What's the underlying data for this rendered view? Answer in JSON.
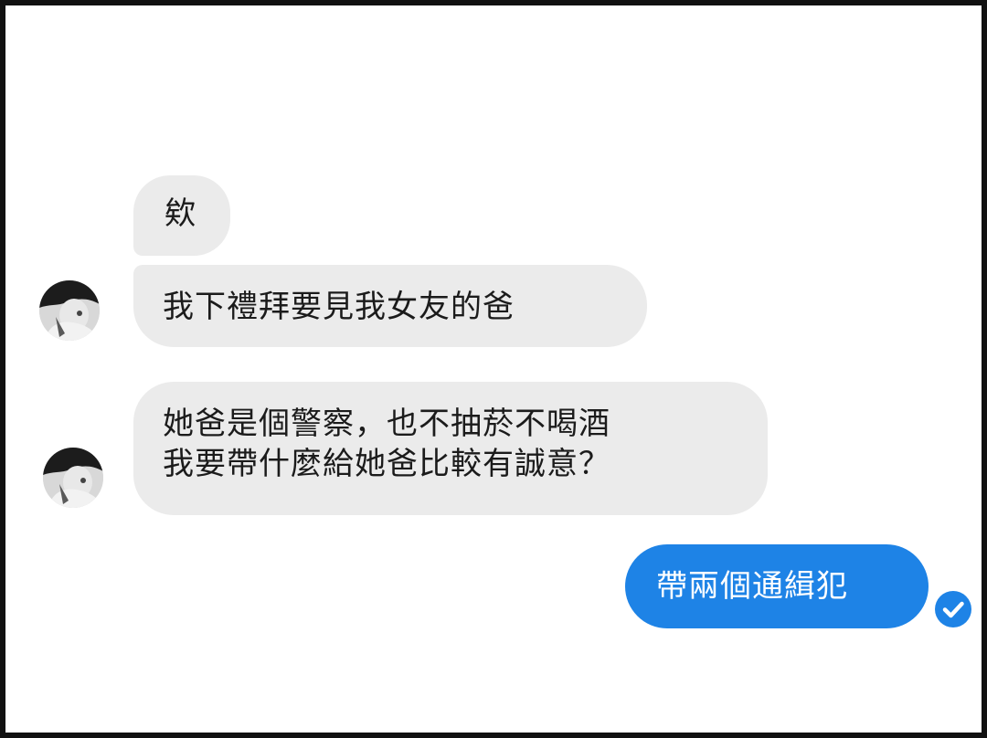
{
  "conversation": {
    "messages": [
      {
        "sender": "other",
        "lines": [
          "欸"
        ]
      },
      {
        "sender": "other",
        "lines": [
          "我下禮拜要見我女友的爸"
        ]
      },
      {
        "sender": "other",
        "lines": [
          "她爸是個警察，也不抽菸不喝酒",
          "我要帶什麼給她爸比較有誠意？"
        ]
      },
      {
        "sender": "me",
        "lines": [
          "帶兩個通緝犯"
        ]
      }
    ],
    "read_status_icon": "check-circle-icon"
  },
  "colors": {
    "incoming_bubble": "#ebebeb",
    "outgoing_bubble": "#1e83e6",
    "incoming_text": "#1b1b1b",
    "outgoing_text": "#ffffff",
    "frame_border": "#111111"
  }
}
